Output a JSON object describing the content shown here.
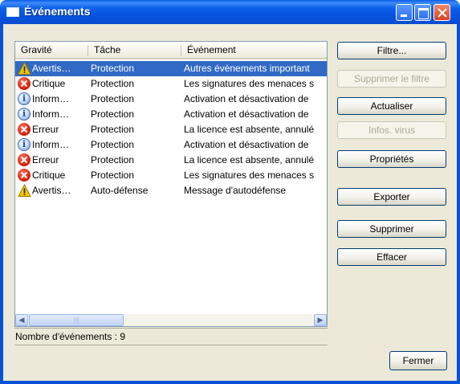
{
  "window": {
    "title": "Événements"
  },
  "list": {
    "columns": [
      "Gravité",
      "Tâche",
      "Événement"
    ],
    "rows": [
      {
        "severity_icon": "warning-icon",
        "severity": "Avertis…",
        "task": "Protection",
        "event": "Autres évènements important",
        "selected": true
      },
      {
        "severity_icon": "error-icon",
        "severity": "Critique",
        "task": "Protection",
        "event": "Les signatures des menaces s",
        "selected": false
      },
      {
        "severity_icon": "info-icon",
        "severity": "Inform…",
        "task": "Protection",
        "event": "Activation et désactivation de",
        "selected": false
      },
      {
        "severity_icon": "info-icon",
        "severity": "Inform…",
        "task": "Protection",
        "event": "Activation et désactivation de",
        "selected": false
      },
      {
        "severity_icon": "error-icon",
        "severity": "Erreur",
        "task": "Protection",
        "event": "La licence est absente, annulé",
        "selected": false
      },
      {
        "severity_icon": "info-icon",
        "severity": "Inform…",
        "task": "Protection",
        "event": "Activation et désactivation de",
        "selected": false
      },
      {
        "severity_icon": "error-icon",
        "severity": "Erreur",
        "task": "Protection",
        "event": "La licence est absente, annulé",
        "selected": false
      },
      {
        "severity_icon": "error-icon",
        "severity": "Critique",
        "task": "Protection",
        "event": "Les signatures des menaces s",
        "selected": false
      },
      {
        "severity_icon": "warning-icon",
        "severity": "Avertis…",
        "task": "Auto-défense",
        "event": "Message d'autodéfense",
        "selected": false
      }
    ]
  },
  "status": {
    "text": "Nombre d'événements : 9"
  },
  "buttons": {
    "filter": "Filtre...",
    "remove_filter": "Supprimer le filtre",
    "refresh": "Actualiser",
    "virus_info": "Infos. virus",
    "properties": "Propriétés",
    "export": "Exporter",
    "delete": "Supprimer",
    "clear": "Effacer",
    "close": "Fermer"
  },
  "colors": {
    "title_bar": "#0a5fe8",
    "selection": "#316ac5",
    "dialog_bg": "#ece9d8",
    "error": "#d8220c",
    "warning": "#f5c400",
    "info": "#3a6ab0"
  }
}
